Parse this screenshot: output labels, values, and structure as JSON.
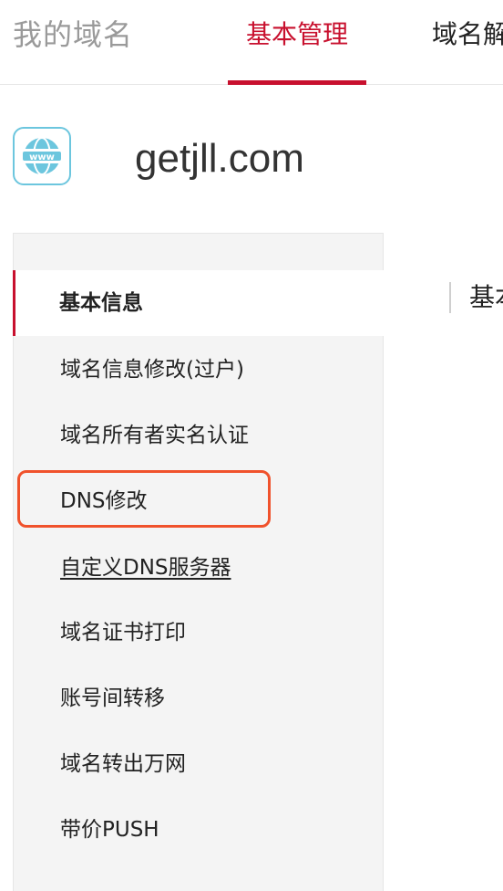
{
  "header": {
    "title": "我的域名",
    "tabs": [
      {
        "label": "基本管理",
        "active": true
      },
      {
        "label": "域名解"
      }
    ]
  },
  "domain": {
    "icon_text": "www",
    "name": "getjll.com"
  },
  "sidebar": {
    "items": [
      {
        "label": "基本信息",
        "active": true
      },
      {
        "label": "域名信息修改(过户)"
      },
      {
        "label": "域名所有者实名认证"
      },
      {
        "label": "DNS修改",
        "highlighted": true
      },
      {
        "label": "自定义DNS服务器",
        "underlined": true
      },
      {
        "label": "域名证书打印"
      },
      {
        "label": "账号间转移"
      },
      {
        "label": "域名转出万网"
      },
      {
        "label": "带价PUSH"
      }
    ]
  },
  "main": {
    "heading": "基本"
  },
  "colors": {
    "accent": "#c8102e",
    "highlight": "#f0522c",
    "icon": "#6cc6de"
  }
}
